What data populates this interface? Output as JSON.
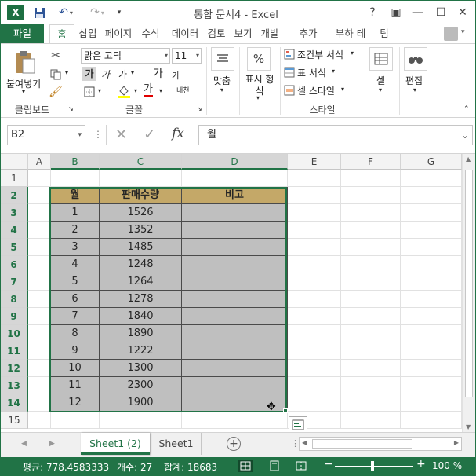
{
  "app": {
    "title": "통합 문서4 - Excel",
    "icon_label": "X"
  },
  "titlebar": {
    "help": "?",
    "ribbon_display": "▣",
    "minimize": "—",
    "maximize": "☐",
    "close": "✕"
  },
  "tabs": [
    "파일",
    "홈",
    "삽입",
    "페이지",
    "수식",
    "데이터",
    "검토",
    "보기",
    "개발",
    "추가",
    "부하 테",
    "팀"
  ],
  "ribbon": {
    "clipboard": {
      "paste": "붙여넣기",
      "label": "클립보드"
    },
    "font": {
      "family": "맑은 고딕",
      "size": "11",
      "bold": "가",
      "italic": "가",
      "underline": "가",
      "grow": "가",
      "shrink": "가",
      "font_color_glyph": "가",
      "phonetic": "내천",
      "label": "글꼴"
    },
    "alignment": {
      "label": "맞춤"
    },
    "number": {
      "label": "표시 형식",
      "percent": "%"
    },
    "styles": {
      "conditional": "조건부 서식",
      "table": "표 서식",
      "cell_style": "셀 스타일",
      "label": "스타일"
    },
    "cells": {
      "label": "셀"
    },
    "editing": {
      "label": "편집"
    }
  },
  "formula_bar": {
    "name_box": "B2",
    "cancel": "✕",
    "enter": "✓",
    "fx": "fx",
    "value": "월"
  },
  "grid": {
    "columns": [
      "A",
      "B",
      "C",
      "D",
      "E",
      "F",
      "G"
    ],
    "rows": [
      "1",
      "2",
      "3",
      "4",
      "5",
      "6",
      "7",
      "8",
      "9",
      "10",
      "11",
      "12",
      "13",
      "14",
      "15"
    ],
    "table": {
      "headers": [
        "월",
        "판매수량",
        "비고"
      ],
      "rows": [
        [
          "1",
          "1526",
          ""
        ],
        [
          "2",
          "1352",
          ""
        ],
        [
          "3",
          "1485",
          ""
        ],
        [
          "4",
          "1248",
          ""
        ],
        [
          "5",
          "1264",
          ""
        ],
        [
          "6",
          "1278",
          ""
        ],
        [
          "7",
          "1840",
          ""
        ],
        [
          "8",
          "1890",
          ""
        ],
        [
          "9",
          "1222",
          ""
        ],
        [
          "10",
          "1300",
          ""
        ],
        [
          "11",
          "2300",
          ""
        ],
        [
          "12",
          "1900",
          ""
        ]
      ]
    }
  },
  "sheets": {
    "active": "Sheet1 (2)",
    "other": "Sheet1",
    "add": "+"
  },
  "status": {
    "average": "평균: 778.4583333",
    "count": "개수: 27",
    "sum": "합계: 18683",
    "zoom": "100 %"
  },
  "colors": {
    "accent": "#217346",
    "table_header": "#c4a868",
    "table_body": "#bfbfbf"
  }
}
